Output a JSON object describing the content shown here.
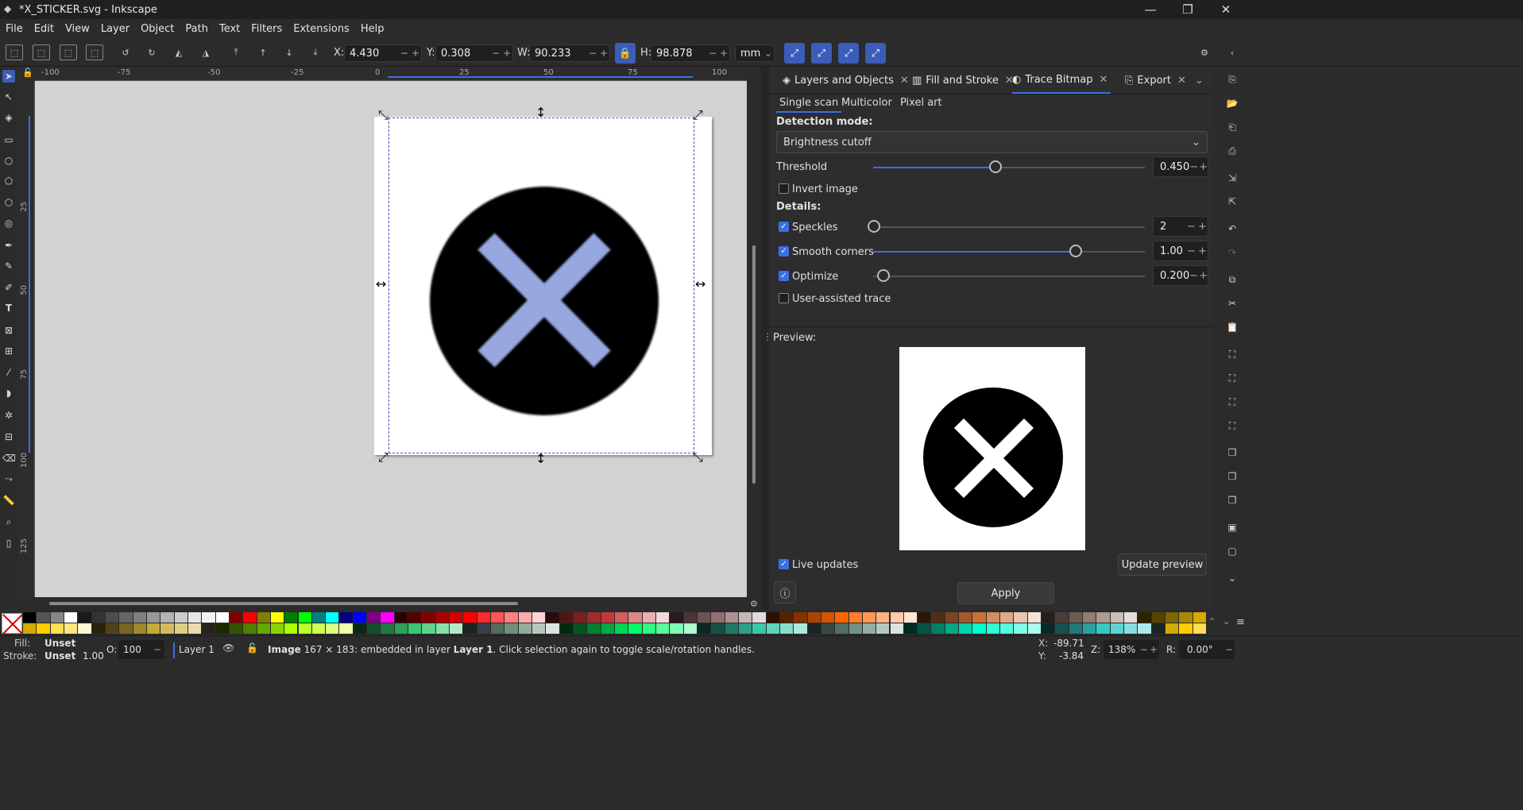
{
  "window": {
    "title": "*X_STICKER.svg - Inkscape",
    "minimize": "—",
    "maximize": "❐",
    "close": "✕"
  },
  "menu": [
    "File",
    "Edit",
    "View",
    "Layer",
    "Object",
    "Path",
    "Text",
    "Filters",
    "Extensions",
    "Help"
  ],
  "toolbar": {
    "x_label": "X:",
    "x_value": "4.430",
    "y_label": "Y:",
    "y_value": "0.308",
    "w_label": "W:",
    "w_value": "90.233",
    "h_label": "H:",
    "h_value": "98.878",
    "unit": "mm"
  },
  "ruler_top_ticks": [
    "-100",
    "-75",
    "-50",
    "-25",
    "0",
    "25",
    "50",
    "75",
    "100"
  ],
  "ruler_left_ticks": [
    "25",
    "50",
    "75",
    "100",
    "125"
  ],
  "dock": {
    "tabs": [
      "Layers and Objects",
      "Fill and Stroke",
      "Trace Bitmap",
      "Export"
    ],
    "subtabs": [
      "Single scan",
      "Multicolor",
      "Pixel art"
    ],
    "detection_mode_label": "Detection mode:",
    "detection_mode_value": "Brightness cutoff",
    "threshold_label": "Threshold",
    "threshold_value": "0.450",
    "threshold_level": 0.45,
    "invert_label": "Invert image",
    "details_label": "Details:",
    "speckles_label": "Speckles",
    "speckles_value": "2",
    "smooth_label": "Smooth corners",
    "smooth_value": "1.00",
    "optimize_label": "Optimize",
    "optimize_value": "0.200",
    "user_assisted_label": "User-assisted trace",
    "preview_label": "Preview:",
    "live_updates_label": "Live updates",
    "update_preview_label": "Update preview",
    "apply_label": "Apply"
  },
  "status": {
    "fill_label": "Fill:",
    "fill_value": "Unset",
    "stroke_label": "Stroke:",
    "stroke_value": "Unset",
    "stroke_width": "1.00",
    "opacity_label": "O:",
    "opacity_value": "100",
    "layer": "Layer 1",
    "message_bold": "Image",
    "message_rest": " 167 × 183: embedded in layer ",
    "message_layer": "Layer 1",
    "message_tail": ". Click selection again to toggle scale/rotation handles.",
    "x_label": "X:",
    "x_value": "-89.71",
    "y_label": "Y:",
    "y_value": "-3.84",
    "zoom_label": "Z:",
    "zoom_value": "138%",
    "rot_label": "R:",
    "rot_value": "0.00°"
  },
  "colors": {
    "accent": "#3a6ee8",
    "sticker_x": "#97a7e0"
  }
}
